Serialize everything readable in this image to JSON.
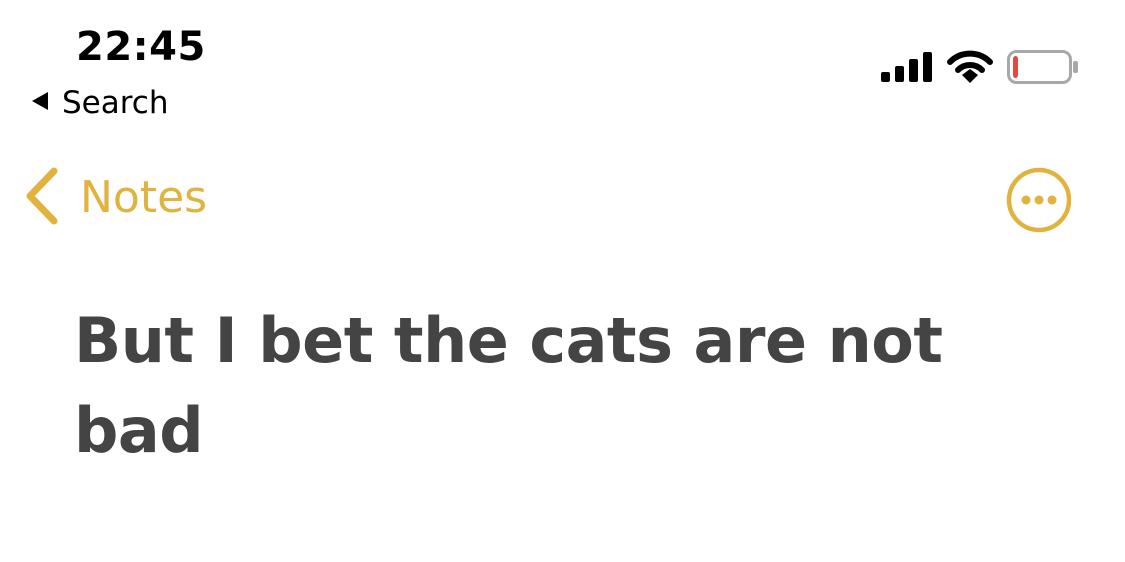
{
  "status_bar": {
    "time": "22:45",
    "back_to_app_label": "Search",
    "battery_level": 0.1,
    "battery_color": "#e5463f",
    "signal_bars": 4,
    "icons": [
      "back-triangle-icon",
      "cellular-signal-icon",
      "wifi-icon",
      "battery-icon"
    ]
  },
  "nav": {
    "back_label": "Notes",
    "accent_color": "#e1b33e",
    "back_icon": "chevron-left-icon",
    "more_icon": "ellipsis-circle-icon"
  },
  "note": {
    "text": "But I bet the cats are not bad",
    "text_color": "#444444"
  }
}
